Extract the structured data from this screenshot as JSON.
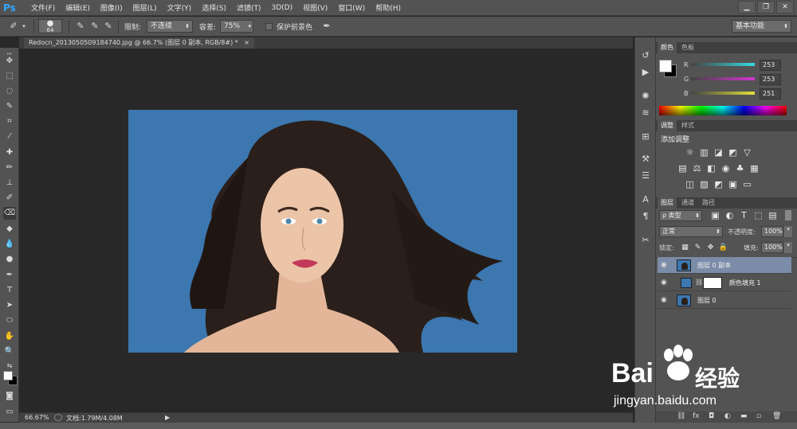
{
  "app": {
    "logo": "Ps"
  },
  "menu": [
    "文件(F)",
    "编辑(E)",
    "图像(I)",
    "图层(L)",
    "文字(Y)",
    "选择(S)",
    "滤镜(T)",
    "3D(D)",
    "视图(V)",
    "窗口(W)",
    "帮助(H)"
  ],
  "window_controls": {
    "minimize": "▁",
    "restore": "❐",
    "close": "✕"
  },
  "options": {
    "brush_size": "64",
    "limit_label": "限制:",
    "limit_value": "不连续",
    "tolerance_label": "容差:",
    "tolerance_value": "75%",
    "protect_label": "保护前景色",
    "workspace": "基本功能"
  },
  "document": {
    "tab_title": "Redocn_2013050509184740.jpg @ 66.7% (图层 0 副本, RGB/8#) *",
    "tab_close": "×"
  },
  "status": {
    "zoom": "66.67%",
    "doc_info": "文档:1.79M/4.08M"
  },
  "color_panel": {
    "tabs": [
      "颜色",
      "色板"
    ],
    "r": "253",
    "g": "253",
    "b": "251",
    "r_label": "R",
    "g_label": "G",
    "b_label": "B",
    "r_color": "#35d9df",
    "g_color": "#d534d0",
    "b_color": "#e0e03a"
  },
  "adjust_panel": {
    "tabs": [
      "调整",
      "样式"
    ],
    "title": "添加调整"
  },
  "layers_panel": {
    "tabs": [
      "图层",
      "通道",
      "路径"
    ],
    "filter_label": "ρ 类型",
    "blend_mode": "正常",
    "opacity_label": "不透明度:",
    "opacity_value": "100%",
    "lock_label": "锁定:",
    "fill_label": "填充:",
    "fill_value": "100%",
    "layers": [
      {
        "name": "图层 0 副本"
      },
      {
        "name": "颜色填充 1"
      },
      {
        "name": "图层 0"
      }
    ]
  },
  "watermark": {
    "brand_text": "Bai",
    "brand_suffix": "经验",
    "url": "jingyan.baidu.com"
  },
  "colors": {
    "canvas_bg": "#3c77b0",
    "selected_layer": "#7b8ca8"
  }
}
